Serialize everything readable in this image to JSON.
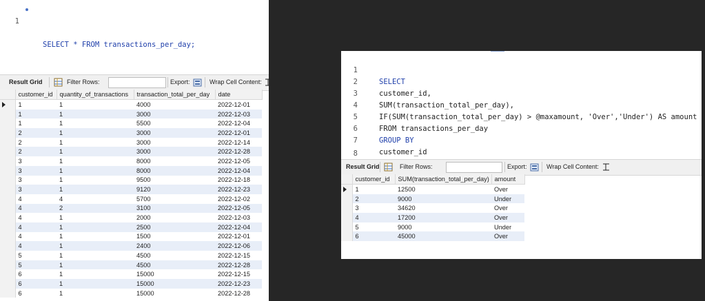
{
  "left": {
    "editor": {
      "lines": [
        {
          "num": "1",
          "code": "SELECT * FROM transactions_per_day;"
        }
      ]
    },
    "toolbar": {
      "result_grid": "Result Grid",
      "filter_rows": "Filter Rows:",
      "export": "Export:",
      "wrap_cell": "Wrap Cell Content:"
    },
    "grid": {
      "columns": [
        "customer_id",
        "quantity_of_transactions",
        "transaction_total_per_day",
        "date"
      ],
      "rows": [
        [
          "1",
          "1",
          "4000",
          "2022-12-01"
        ],
        [
          "1",
          "1",
          "3000",
          "2022-12-03"
        ],
        [
          "1",
          "1",
          "5500",
          "2022-12-04"
        ],
        [
          "2",
          "1",
          "3000",
          "2022-12-01"
        ],
        [
          "2",
          "1",
          "3000",
          "2022-12-14"
        ],
        [
          "2",
          "1",
          "3000",
          "2022-12-28"
        ],
        [
          "3",
          "1",
          "8000",
          "2022-12-05"
        ],
        [
          "3",
          "1",
          "8000",
          "2022-12-04"
        ],
        [
          "3",
          "1",
          "9500",
          "2022-12-18"
        ],
        [
          "3",
          "1",
          "9120",
          "2022-12-23"
        ],
        [
          "4",
          "4",
          "5700",
          "2022-12-02"
        ],
        [
          "4",
          "2",
          "3100",
          "2022-12-05"
        ],
        [
          "4",
          "1",
          "2000",
          "2022-12-03"
        ],
        [
          "4",
          "1",
          "2500",
          "2022-12-04"
        ],
        [
          "4",
          "1",
          "1500",
          "2022-12-01"
        ],
        [
          "4",
          "1",
          "2400",
          "2022-12-06"
        ],
        [
          "5",
          "1",
          "4500",
          "2022-12-15"
        ],
        [
          "5",
          "1",
          "4500",
          "2022-12-28"
        ],
        [
          "6",
          "1",
          "15000",
          "2022-12-15"
        ],
        [
          "6",
          "1",
          "15000",
          "2022-12-23"
        ],
        [
          "6",
          "1",
          "15000",
          "2022-12-28"
        ]
      ]
    }
  },
  "right": {
    "editor": {
      "lines": [
        {
          "num": "1",
          "code": "SELECT"
        },
        {
          "num": "2",
          "code": "customer_id,"
        },
        {
          "num": "3",
          "code": "SUM(transaction_total_per_day),"
        },
        {
          "num": "4",
          "code": "IF(SUM(transaction_total_per_day) > @maxamount, 'Over','Under') AS amount"
        },
        {
          "num": "5",
          "code": "FROM transactions_per_day"
        },
        {
          "num": "6",
          "code": "GROUP BY"
        },
        {
          "num": "7",
          "code": "customer_id"
        },
        {
          "num": "8",
          "code": ""
        }
      ]
    },
    "toolbar": {
      "result_grid": "Result Grid",
      "filter_rows": "Filter Rows:",
      "export": "Export:",
      "wrap_cell": "Wrap Cell Content:"
    },
    "grid": {
      "columns": [
        "customer_id",
        "SUM(transaction_total_per_day)",
        "amount"
      ],
      "rows": [
        [
          "1",
          "12500",
          "Over"
        ],
        [
          "2",
          "9000",
          "Under"
        ],
        [
          "3",
          "34620",
          "Over"
        ],
        [
          "4",
          "17200",
          "Over"
        ],
        [
          "5",
          "9000",
          "Under"
        ],
        [
          "6",
          "45000",
          "Over"
        ]
      ]
    }
  },
  "icons": [
    "grid-icon",
    "export-icon",
    "wrap-icon",
    "row-cursor-icon"
  ]
}
